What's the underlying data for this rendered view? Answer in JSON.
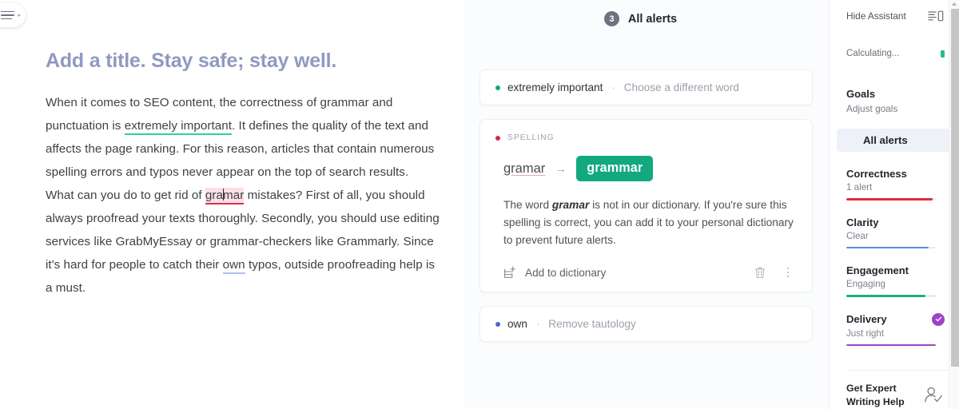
{
  "menu": {
    "icon": "hamburger-menu-icon",
    "chevron": "▸"
  },
  "editor": {
    "title": "Add a title. Stay safe; stay well.",
    "para1_a": "When it comes to SEO content, the correctness of grammar and punctuation is ",
    "para1_highlight": "extremely important",
    "para1_b": ". It defines the quality of the text and affects the page ranking. For this reason, articles that contain numerous spelling errors and typos never appear on the top of search results.",
    "para2_a": "What can you do to get rid of ",
    "para2_error_before": "gra",
    "para2_error_after": "mar",
    "para2_b": " mistakes? First of all, you should always proofread your texts thoroughly. Secondly, you should use editing services like GrabMyEssay or grammar-checkers like Grammarly. Since it's hard for people to catch their ",
    "para2_highlight": "own",
    "para2_c": " typos, outside proofreading help is a must."
  },
  "alerts": {
    "count": "3",
    "header": "All alerts",
    "items": [
      {
        "type": "mini",
        "dot": "green",
        "word": "extremely important",
        "sep": "·",
        "action": "Choose a different word"
      },
      {
        "type": "main",
        "dot": "red",
        "category": "SPELLING",
        "old_word": "gramar",
        "arrow": "→",
        "new_word": "grammar",
        "explain_a": "The word ",
        "explain_bold": "gramar",
        "explain_b": " is not in our dictionary. If you're sure this spelling is correct, you can add it to your personal dictionary to prevent future alerts.",
        "dictionary_label": "Add to dictionary",
        "dictionary_icon": "add-to-dictionary-icon",
        "trash_icon": "trash-icon",
        "menu_icon": "kebab-menu-icon"
      },
      {
        "type": "mini",
        "dot": "blue",
        "word": "own",
        "sep": "·",
        "action": "Remove tautology"
      }
    ]
  },
  "sidebar": {
    "hide_assistant": "Hide Assistant",
    "hide_assistant_icon": "panel-layout-icon",
    "calculating": "Calculating...",
    "goals_title": "Goals",
    "goals_sub": "Adjust goals",
    "all_alerts_tab": "All alerts",
    "metrics": [
      {
        "name": "Correctness",
        "value": "1 alert",
        "percent": 96,
        "color": "#e02b3f",
        "badge": false
      },
      {
        "name": "Clarity",
        "value": "Clear",
        "percent": 92,
        "color": "#5b8ae0",
        "badge": false
      },
      {
        "name": "Engagement",
        "value": "Engaging",
        "percent": 88,
        "color": "#17b187",
        "badge": false
      },
      {
        "name": "Delivery",
        "value": "Just right",
        "percent": 100,
        "color": "#9b45c6",
        "badge": true
      }
    ],
    "expert_line1": "Get Expert",
    "expert_line2": "Writing Help",
    "expert_icon": "person-check-icon"
  },
  "colors": {
    "green": "#12a97e",
    "red": "#d62b47",
    "blue": "#5264d3",
    "purple": "#9b45c6",
    "title": "#9099c0"
  }
}
